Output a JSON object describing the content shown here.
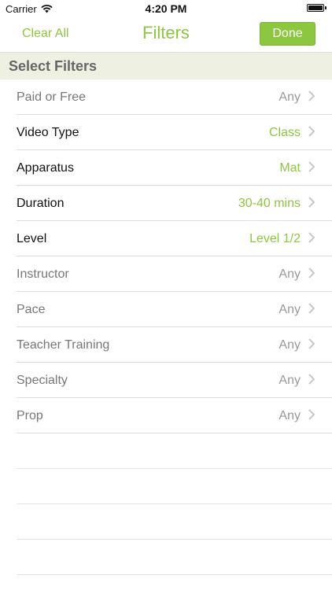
{
  "status_bar": {
    "carrier": "Carrier",
    "time": "4:20 PM",
    "wifi_icon": "wifi-icon",
    "battery_icon": "battery-icon",
    "battery_level": 1.0
  },
  "nav": {
    "clear_all": "Clear All",
    "title": "Filters",
    "done": "Done"
  },
  "section": {
    "title": "Select Filters"
  },
  "filters": [
    {
      "label": "Paid or Free",
      "value": "Any",
      "active": false
    },
    {
      "label": "Video Type",
      "value": "Class",
      "active": true
    },
    {
      "label": "Apparatus",
      "value": "Mat",
      "active": true
    },
    {
      "label": "Duration",
      "value": "30-40 mins",
      "active": true
    },
    {
      "label": "Level",
      "value": "Level 1/2",
      "active": true
    },
    {
      "label": "Instructor",
      "value": "Any",
      "active": false
    },
    {
      "label": "Pace",
      "value": "Any",
      "active": false
    },
    {
      "label": "Teacher Training",
      "value": "Any",
      "active": false
    },
    {
      "label": "Specialty",
      "value": "Any",
      "active": false
    },
    {
      "label": "Prop",
      "value": "Any",
      "active": false
    }
  ],
  "colors": {
    "accent": "#8dc63f",
    "section_bg": "#eef0e2"
  },
  "icons": {
    "row_disclosure": "chevron-right-icon"
  }
}
